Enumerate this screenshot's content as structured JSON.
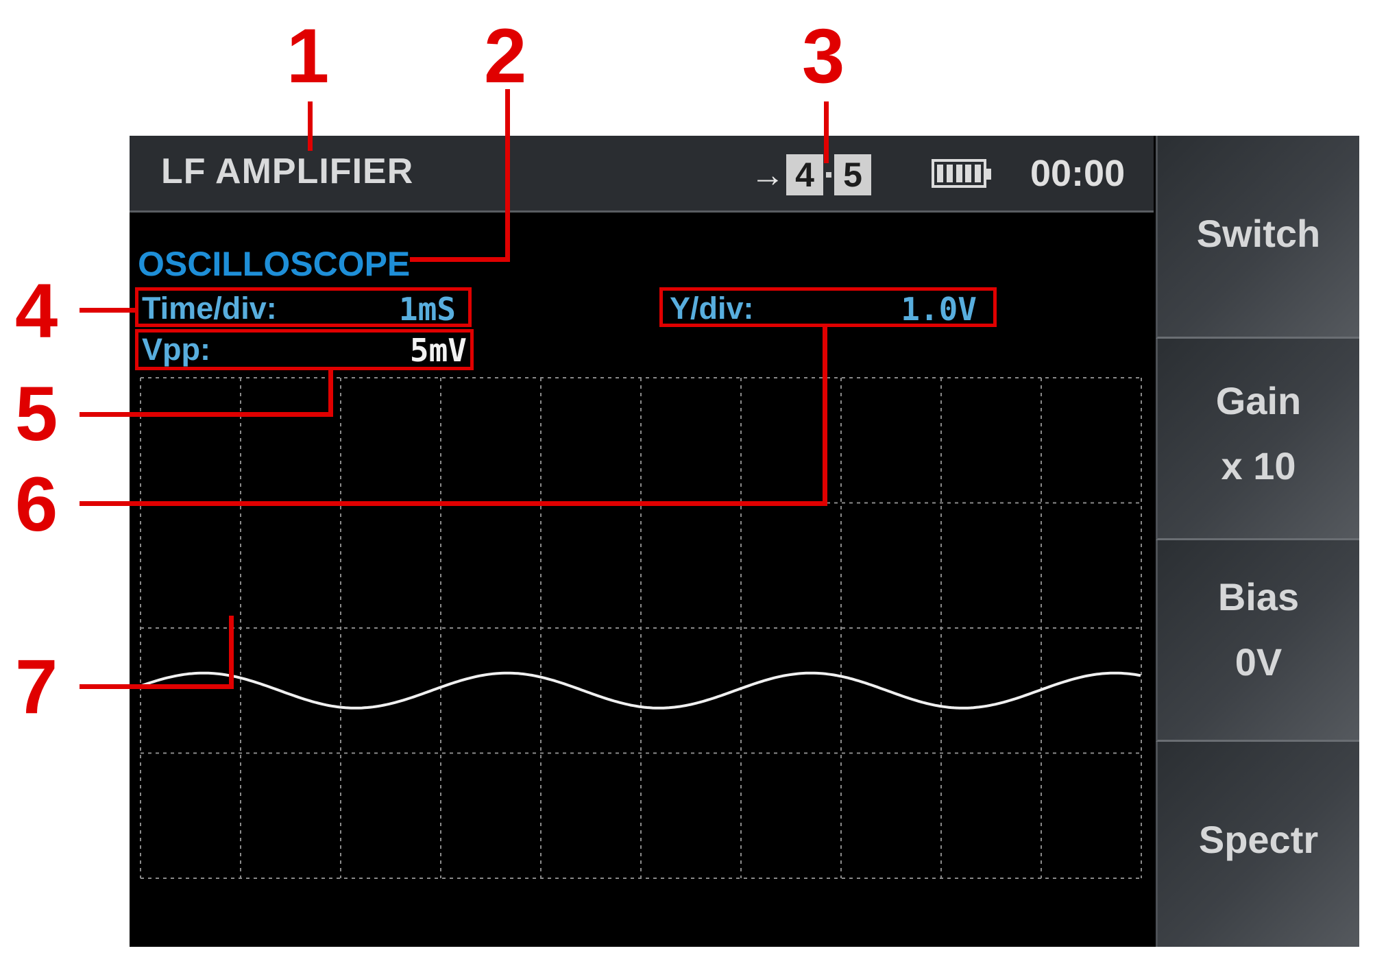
{
  "header": {
    "title": "LF AMPLIFIER",
    "channel_arrow": "→",
    "channel_from": "4",
    "channel_to": "5",
    "battery_icon": "battery-full-icon",
    "clock": "00:00"
  },
  "mode": "OSCILLOSCOPE",
  "readouts": {
    "time_div": {
      "label": "Time/div:",
      "value": "1mS"
    },
    "vpp": {
      "label": "Vpp:",
      "value": "5mV"
    },
    "y_div": {
      "label": "Y/div:",
      "value": "1.0V"
    }
  },
  "side_buttons": [
    {
      "line1": "Switch",
      "line2": ""
    },
    {
      "line1": "Gain",
      "line2": "x 10"
    },
    {
      "line1": "Bias",
      "line2": "0V"
    },
    {
      "line1": "Spectr",
      "line2": ""
    }
  ],
  "callouts": [
    "1",
    "2",
    "3",
    "4",
    "5",
    "6",
    "7"
  ],
  "colors": {
    "accent_blue": "#1e8fd8",
    "readout_blue": "#58aede",
    "annotation_red": "#e00000",
    "waveform": "#f0f0f0"
  },
  "waveform": {
    "periods_visible": 3.3,
    "amplitude_divisions": 0.14,
    "center_division": 2.5
  }
}
